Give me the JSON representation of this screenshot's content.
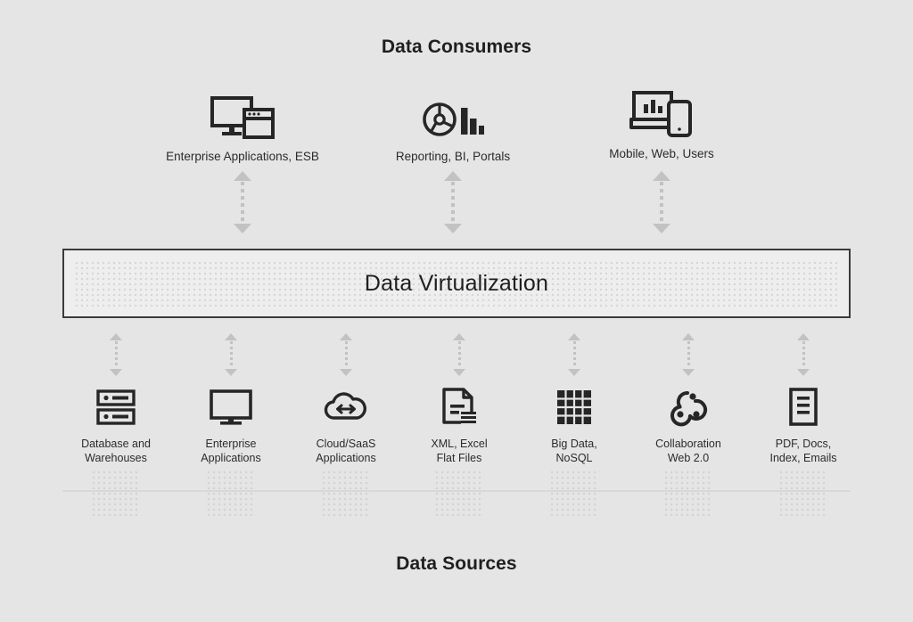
{
  "diagram": {
    "title_top": "Data Consumers",
    "title_bottom": "Data Sources",
    "middle_layer_label": "Data Virtualization",
    "background_color": "#e5e5e5",
    "accent_color": "#262626",
    "arrow_color": "#c2c2c2"
  },
  "consumers": [
    {
      "label": "Enterprise Applications, ESB",
      "icon": "monitor-browser-window-icon"
    },
    {
      "label": "Reporting, BI, Portals",
      "icon": "pie-bar-chart-icon"
    },
    {
      "label": "Mobile, Web, Users",
      "icon": "laptop-phone-icon"
    }
  ],
  "sources": [
    {
      "label_line1": "Database and",
      "label_line2": "Warehouses",
      "icon": "server-rack-icon"
    },
    {
      "label_line1": "Enterprise",
      "label_line2": "Applications",
      "icon": "desktop-monitor-icon"
    },
    {
      "label_line1": "Cloud/SaaS",
      "label_line2": "Applications",
      "icon": "cloud-exchange-icon"
    },
    {
      "label_line1": "XML, Excel",
      "label_line2": "Flat Files",
      "icon": "document-file-icon"
    },
    {
      "label_line1": "Big Data,",
      "label_line2": "NoSQL",
      "icon": "grid-cells-icon"
    },
    {
      "label_line1": "Collaboration",
      "label_line2": "Web 2.0",
      "icon": "webhook-nodes-icon"
    },
    {
      "label_line1": "PDF, Docs,",
      "label_line2": "Index, Emails",
      "icon": "document-lines-icon"
    }
  ]
}
